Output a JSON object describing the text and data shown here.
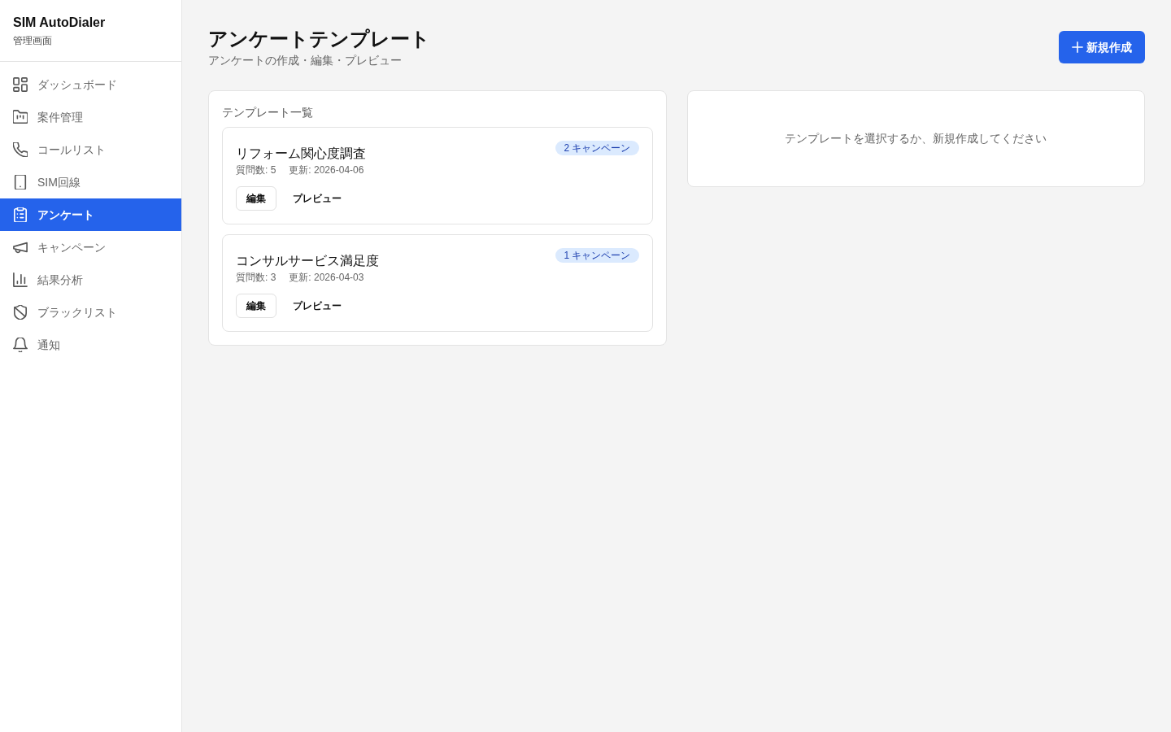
{
  "sidebar": {
    "brand": "SIM AutoDialer",
    "subtitle": "管理画面",
    "items": [
      {
        "label": "ダッシュボード",
        "selected": false
      },
      {
        "label": "案件管理",
        "selected": false
      },
      {
        "label": "コールリスト",
        "selected": false
      },
      {
        "label": "SIM回線",
        "selected": false
      },
      {
        "label": "アンケート",
        "selected": true
      },
      {
        "label": "キャンペーン",
        "selected": false
      },
      {
        "label": "結果分析",
        "selected": false
      },
      {
        "label": "ブラックリスト",
        "selected": false
      },
      {
        "label": "通知",
        "selected": false
      }
    ]
  },
  "header": {
    "title": "アンケートテンプレート",
    "subtitle": "アンケートの作成・編集・プレビュー",
    "new_button": "新規作成"
  },
  "templates_panel": {
    "heading": "テンプレート一覧",
    "templates": [
      {
        "title": "リフォーム関心度調査",
        "campaigns": "2 キャンペーン",
        "questions": "質問数: 5",
        "updated": "更新: 2026-04-06",
        "edit_button": "編集",
        "preview_button": "プレビュー",
        "selected": false
      },
      {
        "title": "コンサルサービス満足度",
        "campaigns": "1 キャンペーン",
        "questions": "質問数: 3",
        "updated": "更新: 2026-04-03",
        "edit_button": "編集",
        "preview_button": "プレビュー",
        "selected": false
      }
    ]
  },
  "detail_panel": {
    "empty_message": "テンプレートを選択するか、新規作成してください"
  }
}
